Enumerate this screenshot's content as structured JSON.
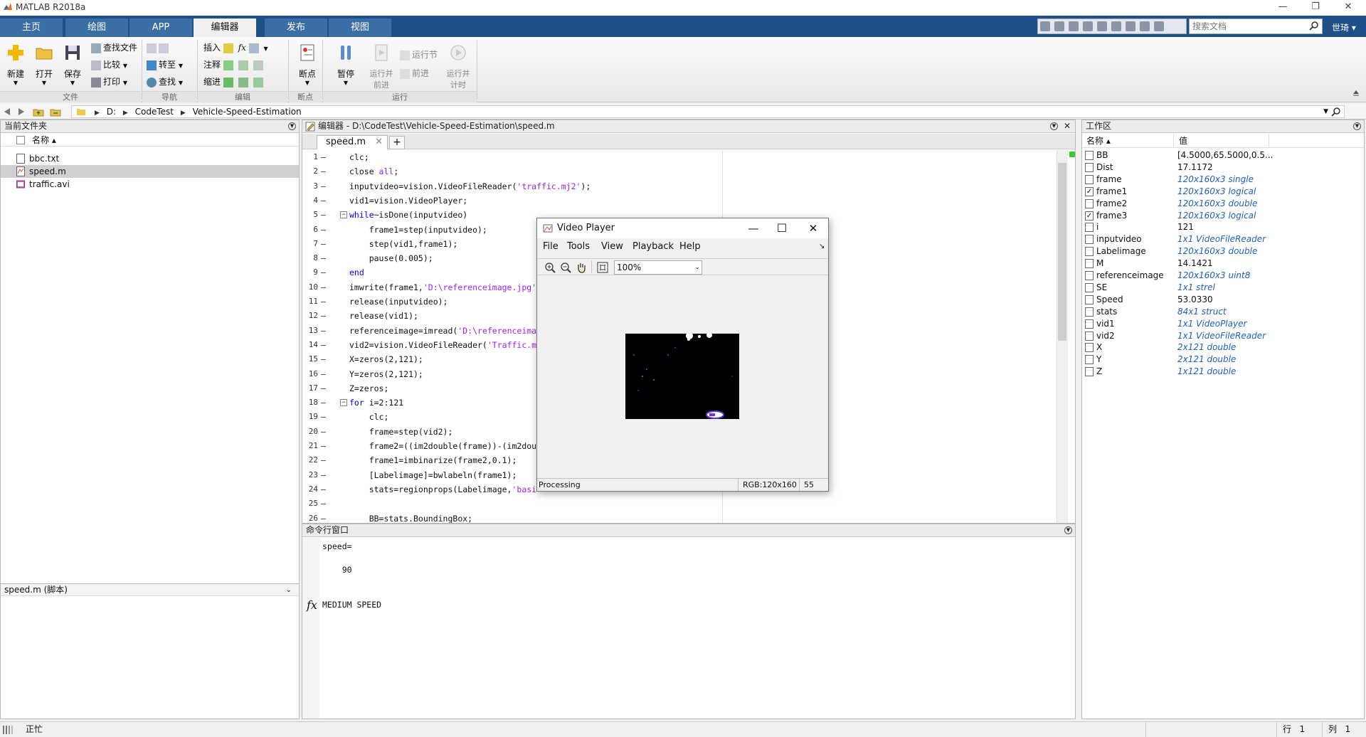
{
  "app": {
    "title": "MATLAB R2018a"
  },
  "window_controls": {
    "minimize": "—",
    "restore": "❐",
    "close": "✕"
  },
  "ribbon_tabs": [
    {
      "label": "主页"
    },
    {
      "label": "绘图"
    },
    {
      "label": "APP"
    },
    {
      "label": "编辑器",
      "active": true
    },
    {
      "label": "发布"
    },
    {
      "label": "视图"
    }
  ],
  "search": {
    "placeholder": "搜索文档"
  },
  "user": {
    "label": "世琦 ▾"
  },
  "toolstrip": {
    "file": {
      "new": "新建",
      "open": "打开",
      "save": "保存",
      "find_files": "查找文件",
      "compare": "比较",
      "print": "打印",
      "group": "文件"
    },
    "navigate": {
      "goto": "转至",
      "find": "查找",
      "group": "导航"
    },
    "edit": {
      "insert": "插入",
      "comment": "注释",
      "indent": "缩进",
      "fx": "fx",
      "group": "编辑"
    },
    "breakpoints": {
      "label": "断点",
      "group": "断点"
    },
    "run": {
      "pause": "暂停",
      "run_advance": "运行并\n前进",
      "run_section": "运行节",
      "advance": "前进",
      "run_time": "运行并\n计时",
      "group": "运行"
    }
  },
  "address": {
    "segments": [
      "D:",
      "CodeTest",
      "Vehicle-Speed-Estimation"
    ]
  },
  "current_folder": {
    "title": "当前文件夹",
    "column": "名称 ▴",
    "files": [
      {
        "name": "bbc.txt",
        "type": "txt"
      },
      {
        "name": "speed.m",
        "type": "m",
        "selected": true
      },
      {
        "name": "traffic.avi",
        "type": "avi"
      }
    ],
    "details": "speed.m  (脚本)"
  },
  "editor": {
    "title": "编辑器 - D:\\CodeTest\\Vehicle-Speed-Estimation\\speed.m",
    "tab": "speed.m",
    "lines": [
      {
        "n": "1",
        "code": [
          [
            "",
            "clc;"
          ]
        ]
      },
      {
        "n": "2",
        "code": [
          [
            "",
            "close "
          ],
          [
            "str",
            "all"
          ],
          [
            "",
            ";"
          ]
        ]
      },
      {
        "n": "3",
        "code": [
          [
            "",
            "inputvideo=vision.VideoFileReader("
          ],
          [
            "str",
            "'traffic.mj2'"
          ],
          [
            "",
            ");"
          ]
        ]
      },
      {
        "n": "4",
        "code": [
          [
            "",
            "vid1=vision.VideoPlayer;"
          ]
        ]
      },
      {
        "n": "5",
        "fold": "−",
        "code": [
          [
            "kw",
            "while"
          ],
          [
            "",
            "~isDone(inputvideo)"
          ]
        ]
      },
      {
        "n": "6",
        "code": [
          [
            "",
            "    frame1=step(inputvideo);"
          ]
        ]
      },
      {
        "n": "7",
        "code": [
          [
            "",
            "    step(vid1,frame1);"
          ]
        ]
      },
      {
        "n": "8",
        "code": [
          [
            "",
            "    pause(0.005);"
          ]
        ]
      },
      {
        "n": "9",
        "code": [
          [
            "kw",
            "end"
          ]
        ]
      },
      {
        "n": "10",
        "code": [
          [
            "",
            "imwrite(frame1,"
          ],
          [
            "str",
            "'D:\\referenceimage.jpg'"
          ]
        ]
      },
      {
        "n": "11",
        "code": [
          [
            "",
            "release(inputvideo);"
          ]
        ]
      },
      {
        "n": "12",
        "code": [
          [
            "",
            "release(vid1);"
          ]
        ]
      },
      {
        "n": "13",
        "code": [
          [
            "",
            "referenceimage=imread("
          ],
          [
            "str",
            "'D:\\referenceima"
          ]
        ]
      },
      {
        "n": "14",
        "code": [
          [
            "",
            "vid2=vision.VideoFileReader("
          ],
          [
            "str",
            "'Traffic.m"
          ]
        ]
      },
      {
        "n": "15",
        "code": [
          [
            "",
            "X=zeros(2,121);"
          ]
        ]
      },
      {
        "n": "16",
        "code": [
          [
            "",
            "Y=zeros(2,121);"
          ]
        ]
      },
      {
        "n": "17",
        "code": [
          [
            "",
            "Z=zeros;"
          ]
        ]
      },
      {
        "n": "18",
        "fold": "−",
        "code": [
          [
            "kw",
            "for"
          ],
          [
            "",
            " i=2:121"
          ]
        ]
      },
      {
        "n": "19",
        "code": [
          [
            "",
            "    clc;"
          ]
        ]
      },
      {
        "n": "20",
        "code": [
          [
            "",
            "    frame=step(vid2);"
          ]
        ]
      },
      {
        "n": "21",
        "code": [
          [
            "",
            "    frame2=((im2double(frame))-(im2dou"
          ]
        ]
      },
      {
        "n": "22",
        "code": [
          [
            "",
            "    frame1=imbinarize(frame2,0.1);"
          ]
        ]
      },
      {
        "n": "23",
        "code": [
          [
            "",
            "    [Labelimage]=bwlabeln(frame1);"
          ]
        ]
      },
      {
        "n": "24",
        "code": [
          [
            "",
            "    stats=regionprops(Labelimage,"
          ],
          [
            "str",
            "'basi"
          ]
        ]
      },
      {
        "n": "25",
        "code": [
          [
            "",
            ""
          ]
        ]
      },
      {
        "n": "26",
        "code": [
          [
            "",
            "    BB=stats.BoundingBox;"
          ]
        ]
      }
    ]
  },
  "command_window": {
    "title": "命令行窗口",
    "lines": [
      "speed=",
      "",
      "    90",
      "",
      "",
      "MEDIUM SPEED"
    ],
    "prompt": "fx"
  },
  "workspace": {
    "title": "工作区",
    "col_name": "名称 ▴",
    "col_value": "值",
    "vars": [
      {
        "name": "BB",
        "value": "[4.5000,65.5000,0.5...",
        "italic": false
      },
      {
        "name": "Dist",
        "value": "17.1172",
        "italic": false
      },
      {
        "name": "frame",
        "value": "120x160x3 single",
        "italic": true
      },
      {
        "name": "frame1",
        "value": "120x160x3 logical",
        "italic": true,
        "check": true
      },
      {
        "name": "frame2",
        "value": "120x160x3 double",
        "italic": true
      },
      {
        "name": "frame3",
        "value": "120x160x3 logical",
        "italic": true,
        "check": true
      },
      {
        "name": "i",
        "value": "121",
        "italic": false
      },
      {
        "name": "inputvideo",
        "value": "1x1 VideoFileReader",
        "italic": true
      },
      {
        "name": "Labelimage",
        "value": "120x160x3 double",
        "italic": true
      },
      {
        "name": "M",
        "value": "14.1421",
        "italic": false
      },
      {
        "name": "referenceimage",
        "value": "120x160x3 uint8",
        "italic": true
      },
      {
        "name": "SE",
        "value": "1x1 strel",
        "italic": true
      },
      {
        "name": "Speed",
        "value": "53.0330",
        "italic": false
      },
      {
        "name": "stats",
        "value": "84x1 struct",
        "italic": true
      },
      {
        "name": "vid1",
        "value": "1x1 VideoPlayer",
        "italic": true
      },
      {
        "name": "vid2",
        "value": "1x1 VideoFileReader",
        "italic": true
      },
      {
        "name": "X",
        "value": "2x121 double",
        "italic": true
      },
      {
        "name": "Y",
        "value": "2x121 double",
        "italic": true
      },
      {
        "name": "Z",
        "value": "1x121 double",
        "italic": true
      }
    ]
  },
  "statusbar": {
    "state": "正忙",
    "row_label": "行",
    "row": "1",
    "col_label": "列",
    "col": "1"
  },
  "video_player": {
    "title": "Video Player",
    "menu": [
      "File",
      "Tools",
      "View",
      "Playback",
      "Help"
    ],
    "zoom": "100%",
    "status": "Processing",
    "rgb": "RGB:120x160",
    "frame": "55"
  },
  "colors": {
    "ribbon_bg": "#1f4f87",
    "keyword": "#0000ff",
    "string": "#a020f0",
    "italic_value": "#1f5fbf"
  }
}
